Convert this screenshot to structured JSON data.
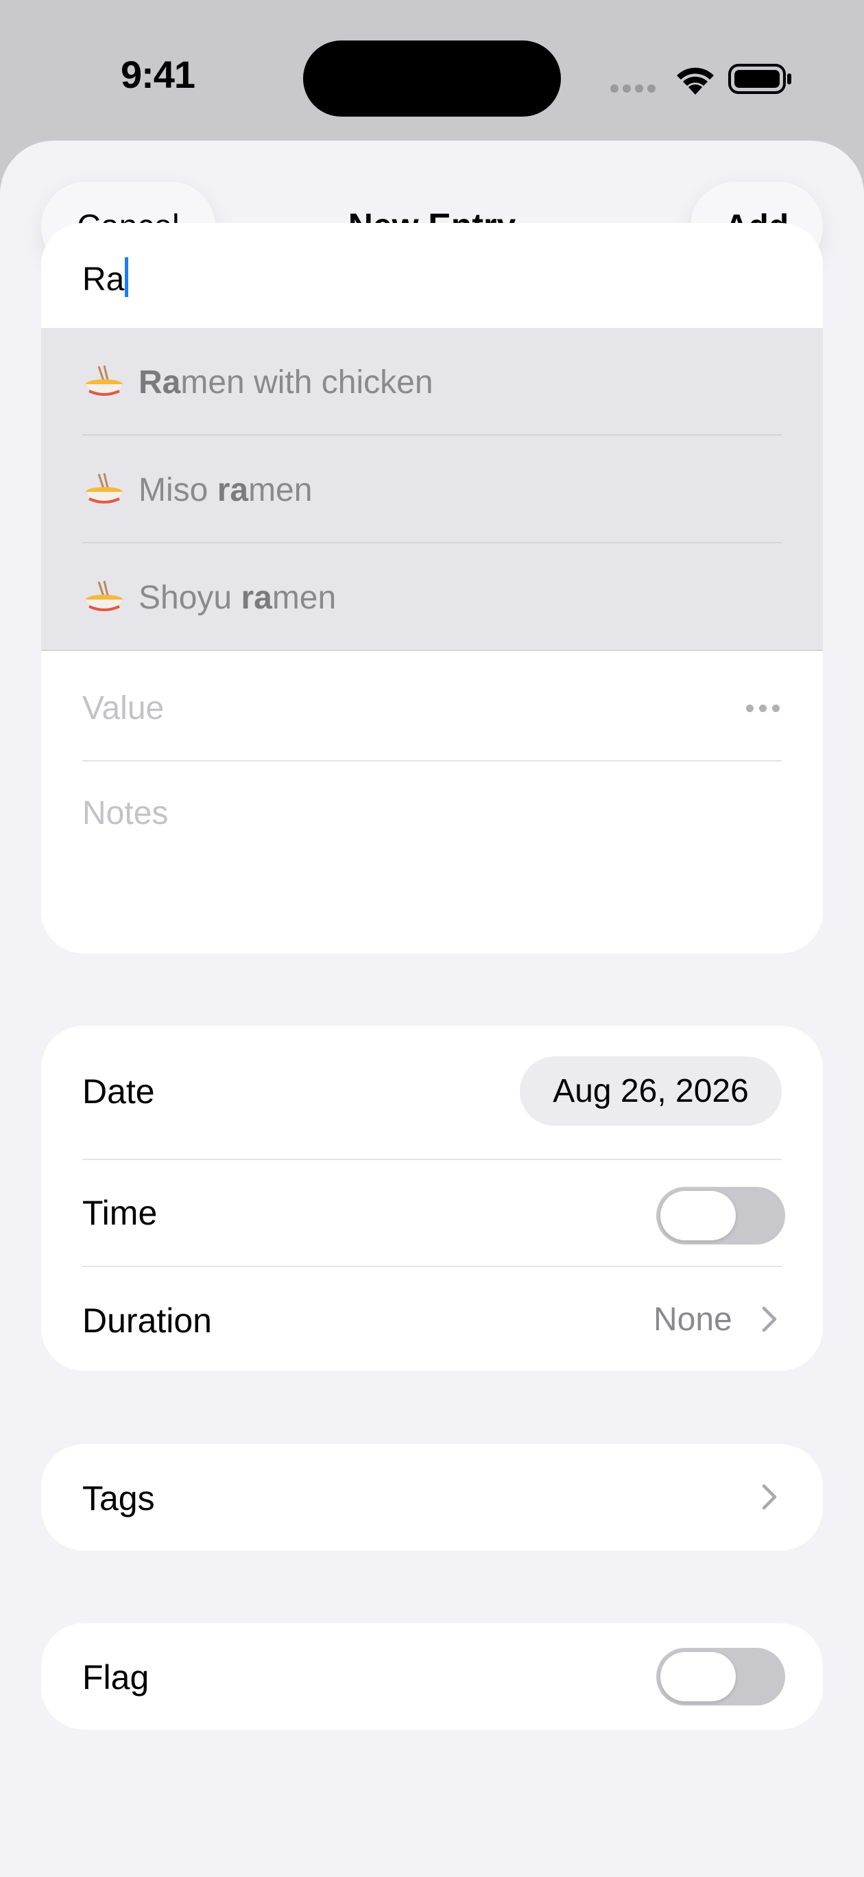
{
  "status_bar": {
    "time": "9:41"
  },
  "nav": {
    "cancel_label": "Cancel",
    "title": "New Entry",
    "add_label": "Add"
  },
  "entry": {
    "name_value": "Ra",
    "suggestions": [
      {
        "icon": "ramen-bowl-icon",
        "before": "",
        "match": "Ra",
        "after": "men with chicken"
      },
      {
        "icon": "ramen-bowl-icon",
        "before": "Miso ",
        "match": "ra",
        "after": "men"
      },
      {
        "icon": "ramen-bowl-icon",
        "before": "Shoyu ",
        "match": "ra",
        "after": "men"
      }
    ],
    "value_placeholder": "Value",
    "notes_placeholder": "Notes"
  },
  "datetime": {
    "date_label": "Date",
    "date_value": "Aug 26, 2026",
    "time_label": "Time",
    "time_enabled": false,
    "duration_label": "Duration",
    "duration_value": "None"
  },
  "tags": {
    "label": "Tags"
  },
  "flag": {
    "label": "Flag",
    "enabled": false
  },
  "colors": {
    "accent": "#1a7df5",
    "background": "#f2f2f7",
    "toggle_off": "#c7c7cc"
  }
}
